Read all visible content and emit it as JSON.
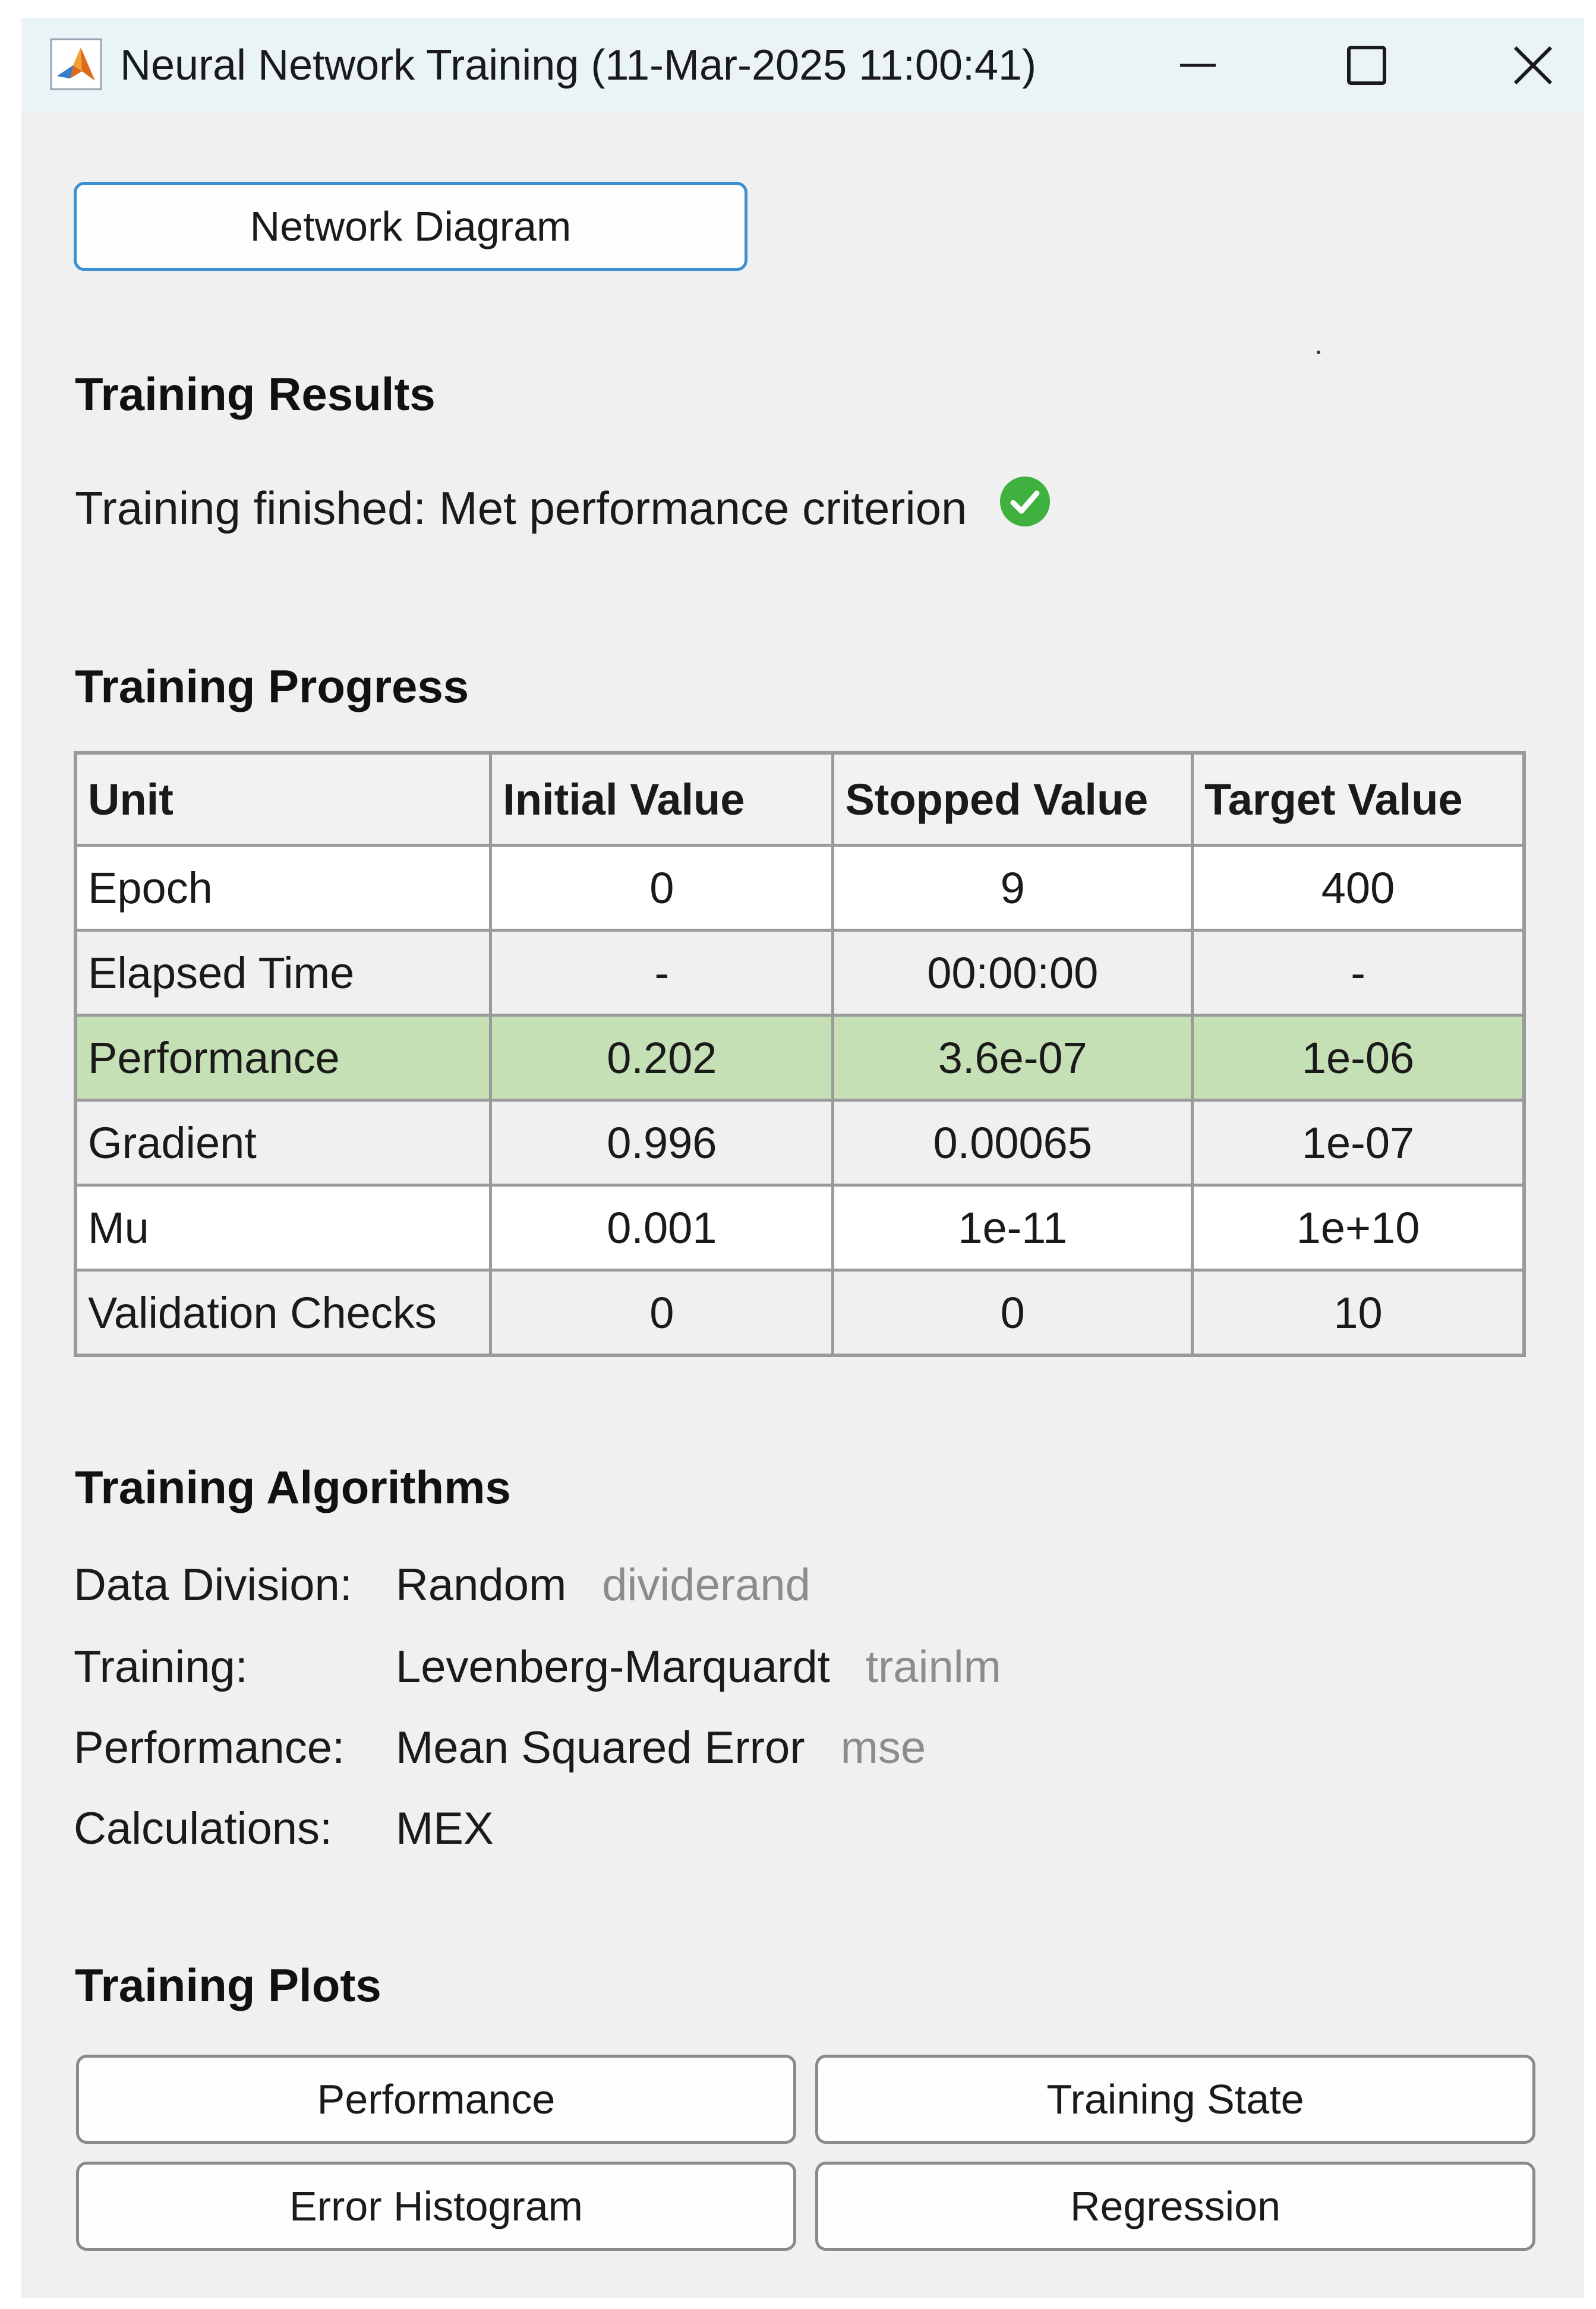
{
  "window": {
    "title": "Neural Network Training (11-Mar-2025 11:00:41)",
    "app_icon": "matlab-icon",
    "controls": [
      "minimize-icon",
      "maximize-icon",
      "close-icon"
    ]
  },
  "toolbar": {
    "network_diagram_label": "Network Diagram"
  },
  "results": {
    "heading": "Training Results",
    "status": "Training finished: Met performance criterion",
    "status_icon": "check-circle-icon",
    "status_color": "#3eb13e"
  },
  "progress": {
    "heading": "Training Progress",
    "columns": [
      "Unit",
      "Initial Value",
      "Stopped Value",
      "Target Value"
    ],
    "rows": [
      {
        "unit": "Epoch",
        "initial": "0",
        "stopped": "9",
        "target": "400"
      },
      {
        "unit": "Elapsed Time",
        "initial": "-",
        "stopped": "00:00:00",
        "target": "-"
      },
      {
        "unit": "Performance",
        "initial": "0.202",
        "stopped": "3.6e-07",
        "target": "1e-06"
      },
      {
        "unit": "Gradient",
        "initial": "0.996",
        "stopped": "0.00065",
        "target": "1e-07"
      },
      {
        "unit": "Mu",
        "initial": "0.001",
        "stopped": "1e-11",
        "target": "1e+10"
      },
      {
        "unit": "Validation Checks",
        "initial": "0",
        "stopped": "0",
        "target": "10"
      }
    ],
    "highlight_color": "#c5e0b4"
  },
  "algorithms": {
    "heading": "Training Algorithms",
    "items": [
      {
        "label": "Data Division:",
        "value": "Random",
        "fn": "dividerand"
      },
      {
        "label": "Training:",
        "value": "Levenberg-Marquardt",
        "fn": "trainlm"
      },
      {
        "label": "Performance:",
        "value": "Mean Squared Error",
        "fn": "mse"
      },
      {
        "label": "Calculations:",
        "value": "MEX",
        "fn": ""
      }
    ]
  },
  "plots": {
    "heading": "Training Plots",
    "buttons": [
      "Performance",
      "Training State",
      "Error Histogram",
      "Regression"
    ]
  }
}
